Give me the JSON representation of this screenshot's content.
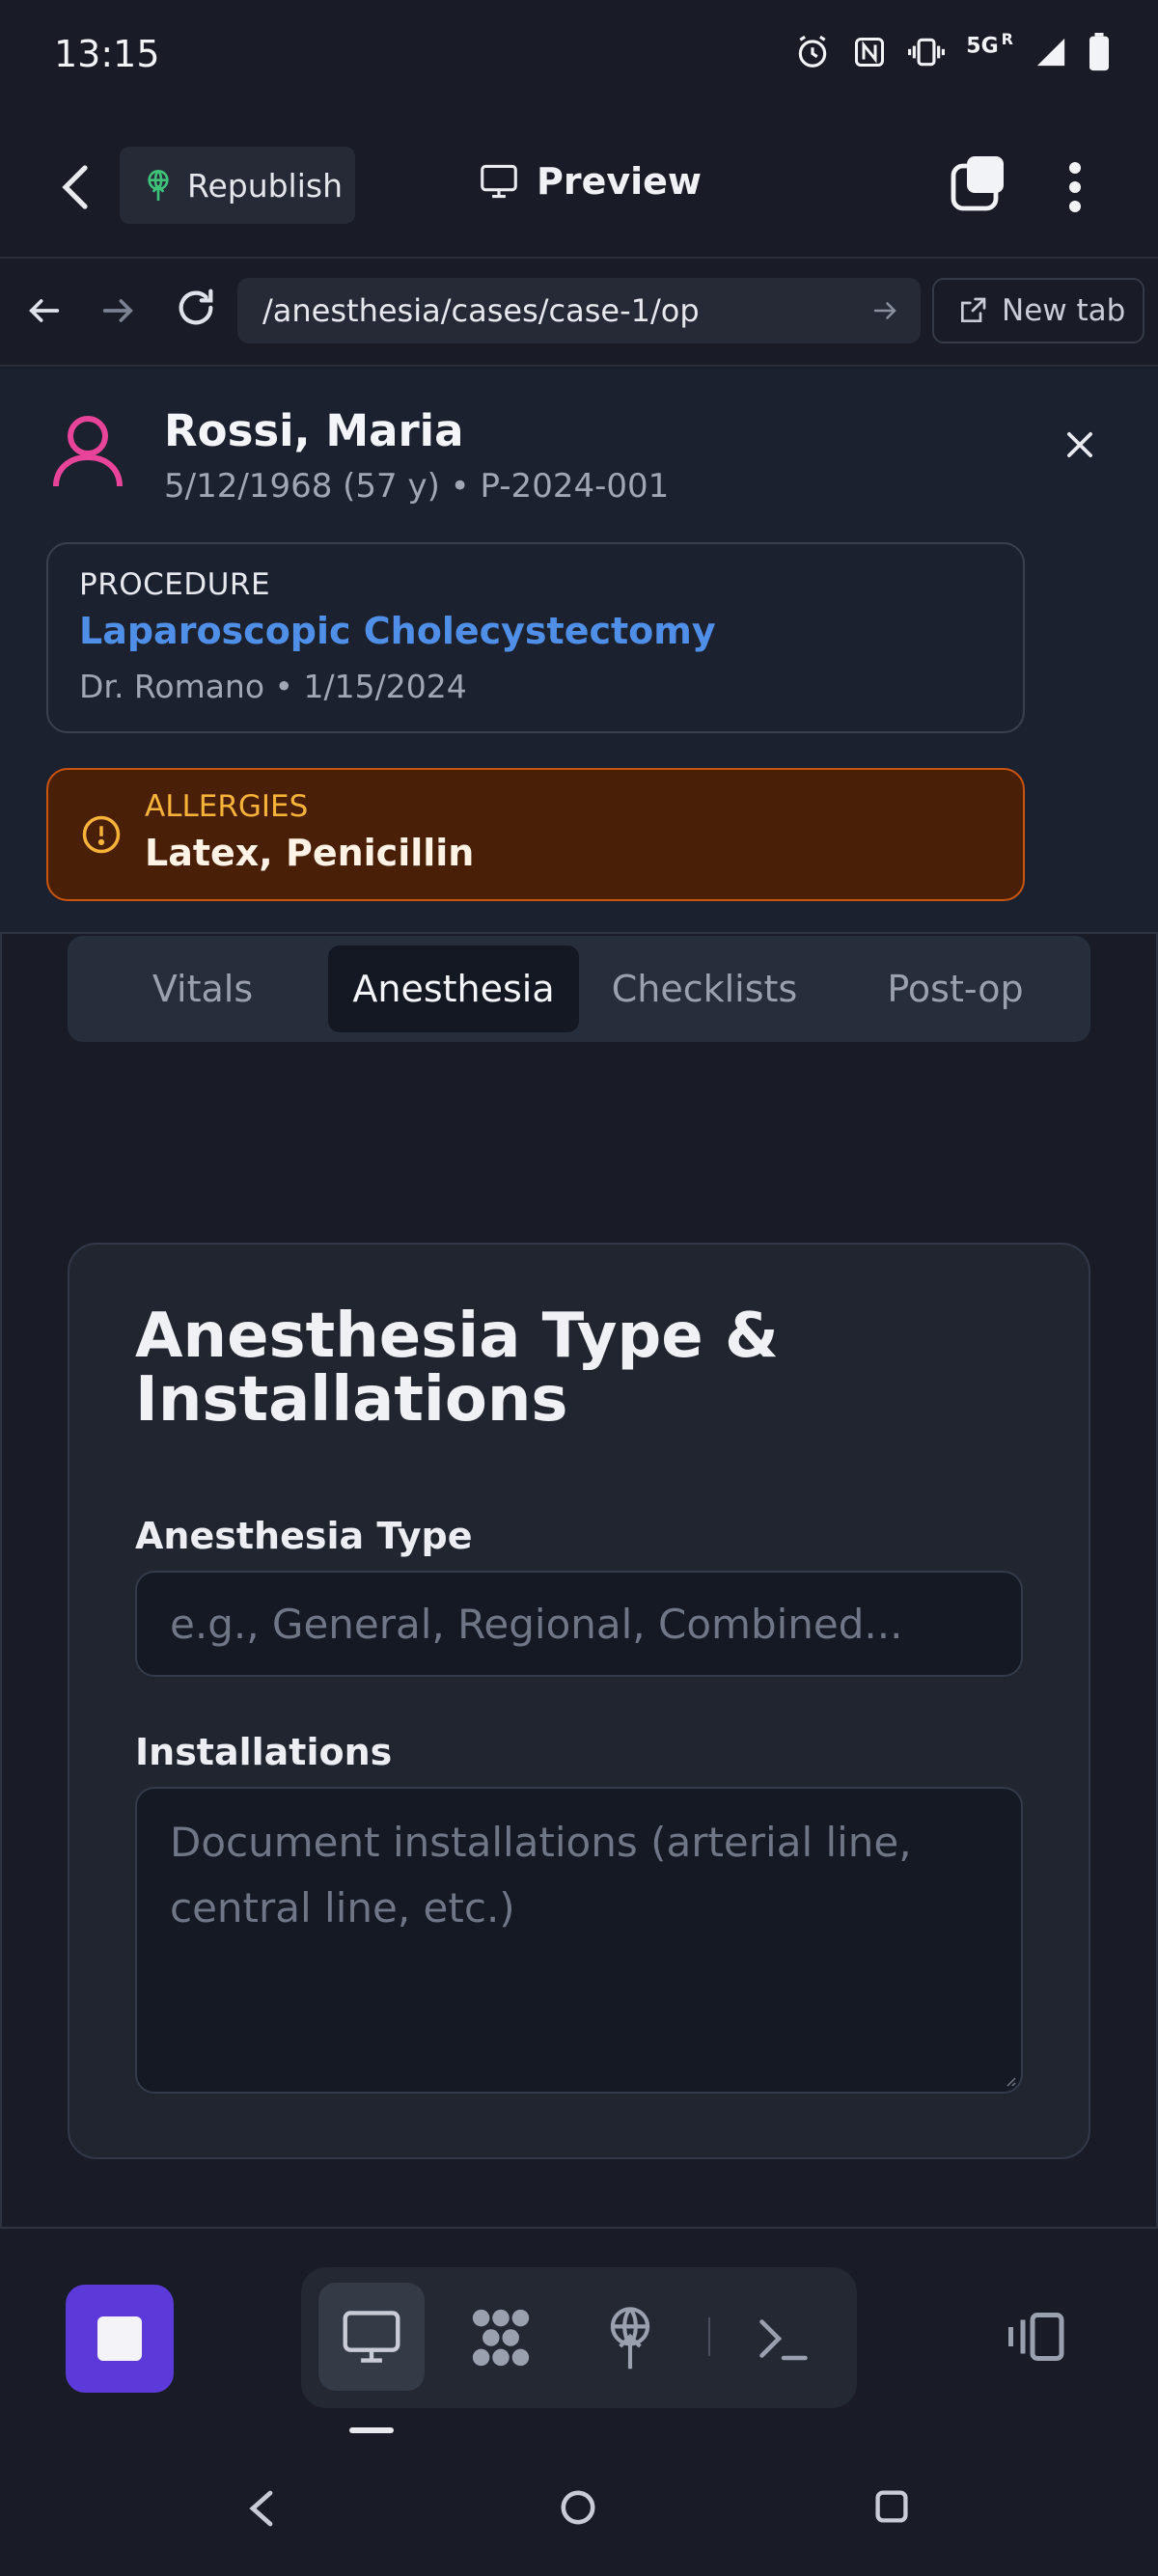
{
  "status_bar": {
    "time": "13:15",
    "network": "5G",
    "roaming": "R",
    "icons": [
      "alarm-icon",
      "nfc-icon",
      "vibrate-icon",
      "signal-icon",
      "battery-icon"
    ]
  },
  "header": {
    "republish_label": "Republish",
    "preview_label": "Preview"
  },
  "browser": {
    "url": "/anesthesia/cases/case-1/op",
    "new_tab_label": "New tab"
  },
  "patient": {
    "name": "Rossi, Maria",
    "meta": "5/12/1968 (57 y) • P-2024-001"
  },
  "procedure": {
    "label": "PROCEDURE",
    "name": "Laparoscopic Cholecystectomy",
    "meta": "Dr. Romano • 1/15/2024"
  },
  "allergies": {
    "label": "ALLERGIES",
    "value": "Latex, Penicillin"
  },
  "tabs": [
    {
      "label": "Vitals",
      "active": false
    },
    {
      "label": "Anesthesia",
      "active": true
    },
    {
      "label": "Checklists",
      "active": false
    },
    {
      "label": "Post-op",
      "active": false
    }
  ],
  "anesthesia_card": {
    "title": "Anesthesia Type & Installations",
    "type_label": "Anesthesia Type",
    "type_placeholder": "e.g., General, Regional, Combined...",
    "type_value": "",
    "installations_label": "Installations",
    "installations_placeholder": "Document installations (arterial line, central line, etc.)",
    "installations_value": ""
  },
  "colors": {
    "accent_purple": "#5b3ad9",
    "procedure_blue": "#4f8fe8",
    "allergy_bg": "#4a1f08",
    "allergy_border": "#c9540f",
    "allergy_label": "#f7b23a",
    "avatar_pink": "#e8449a",
    "republish_green": "#3ec27a"
  }
}
